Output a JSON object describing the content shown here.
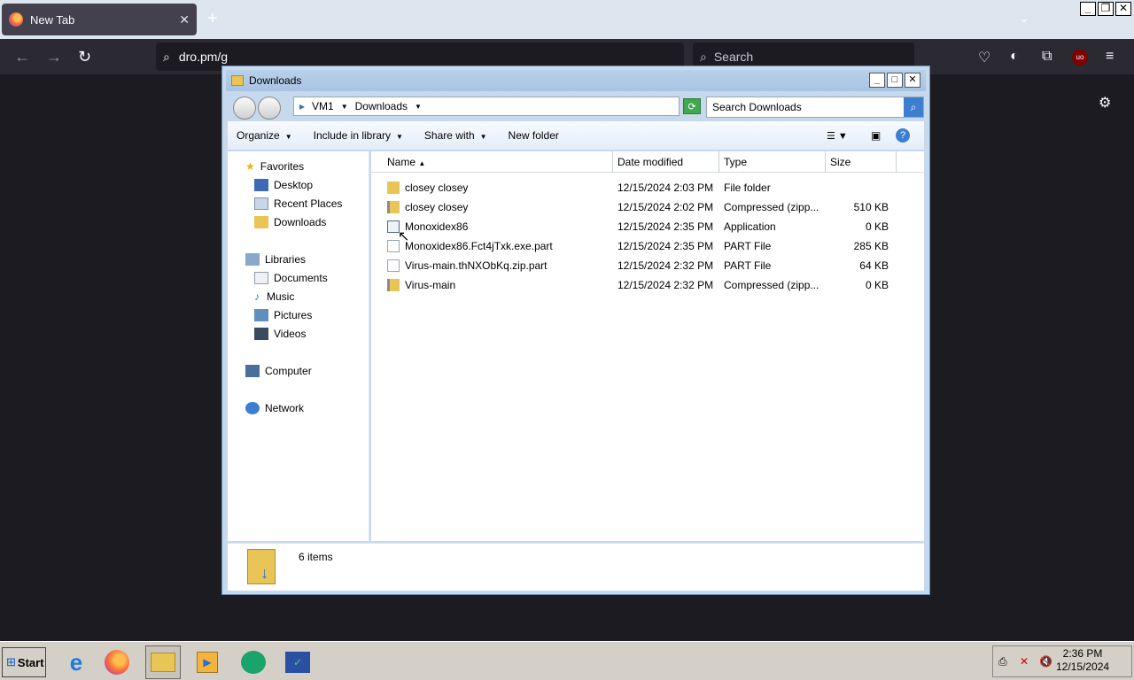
{
  "browser": {
    "tab_title": "New Tab",
    "tab_close": "✕",
    "new_tab": "+",
    "url": "dro.pm/g",
    "search_placeholder": "Search",
    "extension_badge": "uo",
    "win_controls": {
      "min": "_",
      "restore": "❐",
      "close": "✕"
    }
  },
  "explorer": {
    "title": "Downloads",
    "breadcrumb": [
      "VM1",
      "Downloads"
    ],
    "search_placeholder": "Search Downloads",
    "toolbar": {
      "organize": "Organize",
      "include_in_library": "Include in library",
      "share_with": "Share with",
      "new_folder": "New folder"
    },
    "nav": {
      "favorites": "Favorites",
      "desktop": "Desktop",
      "recent_places": "Recent Places",
      "downloads": "Downloads",
      "libraries": "Libraries",
      "documents": "Documents",
      "music": "Music",
      "pictures": "Pictures",
      "videos": "Videos",
      "computer": "Computer",
      "network": "Network"
    },
    "columns": {
      "name": "Name",
      "date": "Date modified",
      "type": "Type",
      "size": "Size"
    },
    "files": [
      {
        "name": "closey closey",
        "date": "12/15/2024 2:03 PM",
        "type": "File folder",
        "size": ""
      },
      {
        "name": "closey closey",
        "date": "12/15/2024 2:02 PM",
        "type": "Compressed (zipp...",
        "size": "510 KB"
      },
      {
        "name": "Monoxidex86",
        "date": "12/15/2024 2:35 PM",
        "type": "Application",
        "size": "0 KB"
      },
      {
        "name": "Monoxidex86.Fct4jTxk.exe.part",
        "date": "12/15/2024 2:35 PM",
        "type": "PART File",
        "size": "285 KB"
      },
      {
        "name": "Virus-main.thNXObKq.zip.part",
        "date": "12/15/2024 2:32 PM",
        "type": "PART File",
        "size": "64 KB"
      },
      {
        "name": "Virus-main",
        "date": "12/15/2024 2:32 PM",
        "type": "Compressed (zipp...",
        "size": "0 KB"
      }
    ],
    "status": "6 items"
  },
  "taskbar": {
    "start": "Start",
    "time": "2:36 PM",
    "date": "12/15/2024"
  }
}
